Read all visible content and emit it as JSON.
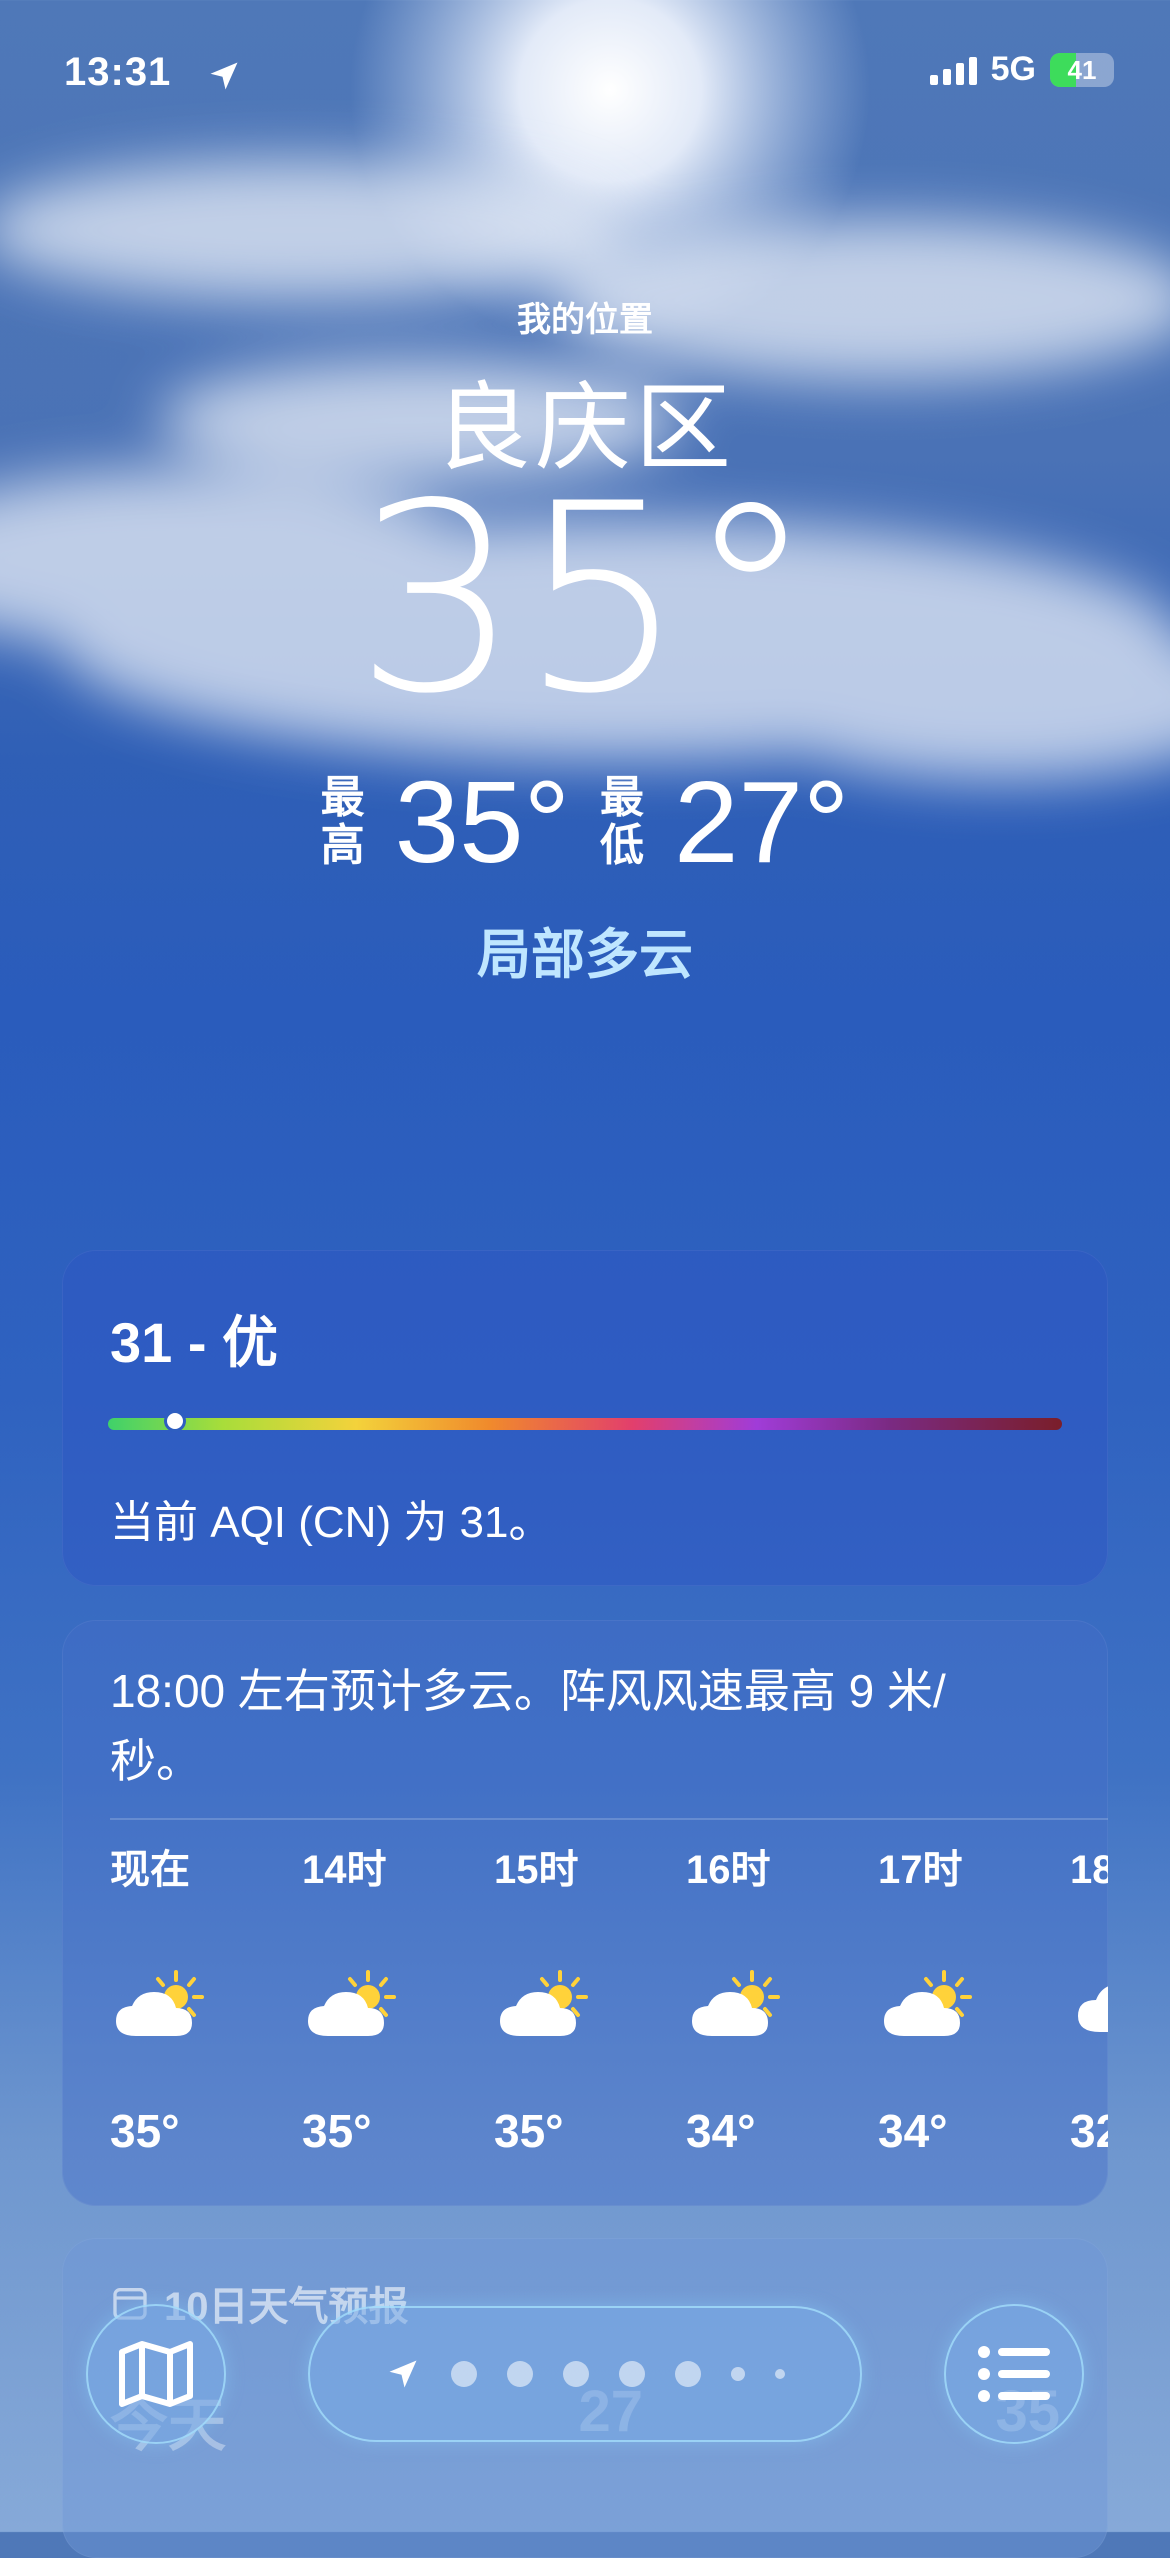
{
  "status_bar": {
    "time": "13:31",
    "network": "5G",
    "battery": "41",
    "battery_level": 0.41
  },
  "location": {
    "label": "我的位置",
    "city": "良庆区",
    "temperature": "35°",
    "high_label": "最高",
    "high": "35°",
    "low_label": "最低",
    "low": "27°",
    "condition": "局部多云"
  },
  "aqi": {
    "title": "31 - 优",
    "description": "当前 AQI (CN) 为 31。",
    "level_fraction": 0.07
  },
  "hourly": {
    "summary": "18:00 左右预计多云。阵风风速最高 9 米/秒。",
    "hours": [
      {
        "label": "现在",
        "icon": "partly-sunny-icon",
        "temp": "35°"
      },
      {
        "label": "14时",
        "icon": "partly-sunny-icon",
        "temp": "35°"
      },
      {
        "label": "15时",
        "icon": "partly-sunny-icon",
        "temp": "35°"
      },
      {
        "label": "16时",
        "icon": "partly-sunny-icon",
        "temp": "34°"
      },
      {
        "label": "17时",
        "icon": "partly-sunny-icon",
        "temp": "34°"
      },
      {
        "label": "18",
        "icon": "cloud-icon",
        "temp": "32"
      }
    ]
  },
  "ten_day": {
    "title": "10日天气预报",
    "first_day": "今天",
    "first_low": "27",
    "first_high": "35"
  },
  "toolbar": {
    "map_icon": "map-icon",
    "list_icon": "list-icon",
    "page_count": 7
  },
  "colors": {
    "condition_text": "#bfe6ff",
    "aqi_good": "#3fd16a",
    "battery_fill": "#3ddc5b"
  }
}
